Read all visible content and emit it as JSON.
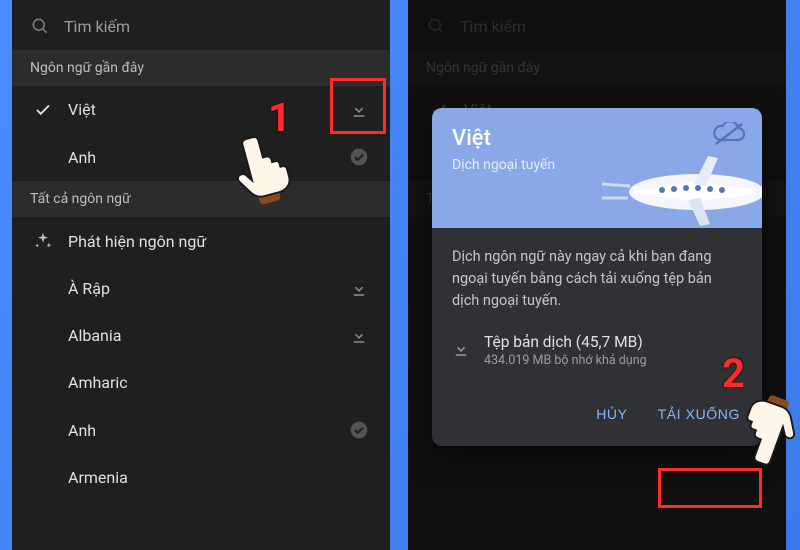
{
  "search": {
    "placeholder": "Tìm kiếm"
  },
  "sections": {
    "recent": "Ngôn ngữ gần đây",
    "all": "Tất cả ngôn ngữ"
  },
  "detect_label": "Phát hiện ngôn ngữ",
  "recent_langs": [
    {
      "name": "Việt",
      "selected": true,
      "status": "download"
    },
    {
      "name": "Anh",
      "selected": false,
      "status": "done"
    }
  ],
  "all_langs": [
    {
      "name": "À Rập",
      "status": "download"
    },
    {
      "name": "Albania",
      "status": "download"
    },
    {
      "name": "Amharic",
      "status": "none"
    },
    {
      "name": "Anh",
      "status": "done"
    },
    {
      "name": "Armenia",
      "status": "none"
    }
  ],
  "dialog": {
    "title": "Việt",
    "subtitle": "Dịch ngoại tuyến",
    "desc": "Dịch ngôn ngữ này ngay cả khi bạn đang ngoại tuyến bằng cách tải xuống tệp bản dịch ngoại tuyến.",
    "file_title": "Tệp bản dịch (45,7 MB)",
    "file_sub": "434.019 MB bộ nhớ khả dụng",
    "cancel": "HỦY",
    "confirm": "TẢI XUỐNG"
  },
  "steps": {
    "one": "1",
    "two": "2"
  }
}
